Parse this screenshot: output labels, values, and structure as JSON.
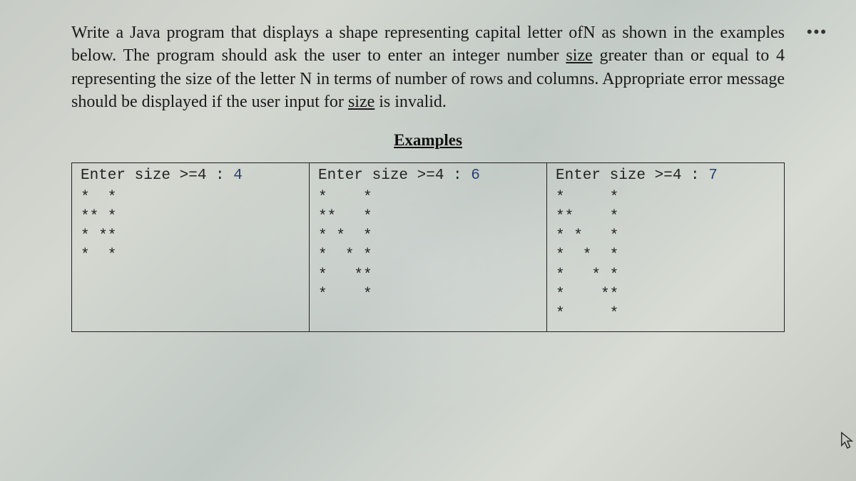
{
  "prompt": {
    "line1_a": "Write a Java program that displays a shape representing capital letter of",
    "line1_n": "N",
    "line1_b": " as shown in the examples below. The program should ask the user to enter an integer number ",
    "size1": "size",
    "line1_c": " greater than or equal to 4 representing the size of the letter N in terms of number of rows and columns. Appropriate error message should be displayed if the user input for ",
    "size2": "size",
    "line1_d": " is invalid."
  },
  "examples_heading": "Examples",
  "examples": [
    {
      "prompt_label": "Enter size >=4 : ",
      "user_input": "4",
      "output": "*  *\n** *\n* **\n*  *"
    },
    {
      "prompt_label": "Enter size >=4 : ",
      "user_input": "6",
      "output": "*    *\n**   *\n* *  *\n*  * *\n*   **\n*    *"
    },
    {
      "prompt_label": "Enter size >=4 : ",
      "user_input": "7",
      "output": "*     *\n**    *\n* *   *\n*  *  *\n*   * *\n*    **\n*     *"
    }
  ],
  "icons": {
    "more": "•••"
  }
}
